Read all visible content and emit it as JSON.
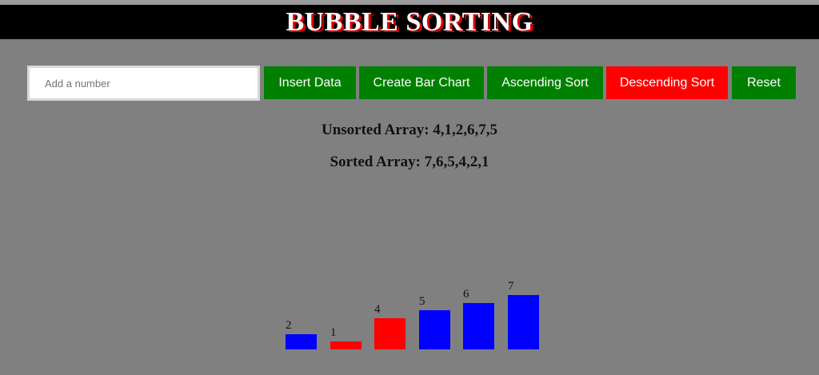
{
  "header": {
    "title": "BUBBLE SORTING"
  },
  "controls": {
    "input_placeholder": "Add a number",
    "insert_label": "Insert Data",
    "create_chart_label": "Create Bar Chart",
    "ascending_label": "Ascending Sort",
    "descending_label": "Descending Sort",
    "reset_label": "Reset"
  },
  "info": {
    "unsorted": "Unsorted Array: 4,1,2,6,7,5",
    "sorted": "Sorted Array: 7,6,5,4,2,1"
  },
  "colors": {
    "green": "#008000",
    "red": "#ff0000",
    "blue": "#0000ff",
    "background": "#808080"
  },
  "chart_data": {
    "type": "bar",
    "categories": [
      "2",
      "1",
      "4",
      "5",
      "6",
      "7"
    ],
    "values": [
      2,
      1,
      4,
      5,
      6,
      7
    ],
    "bar_colors": [
      "#0000ff",
      "#ff0000",
      "#ff0000",
      "#0000ff",
      "#0000ff",
      "#0000ff"
    ],
    "title": "",
    "xlabel": "",
    "ylabel": "",
    "grid": false
  }
}
